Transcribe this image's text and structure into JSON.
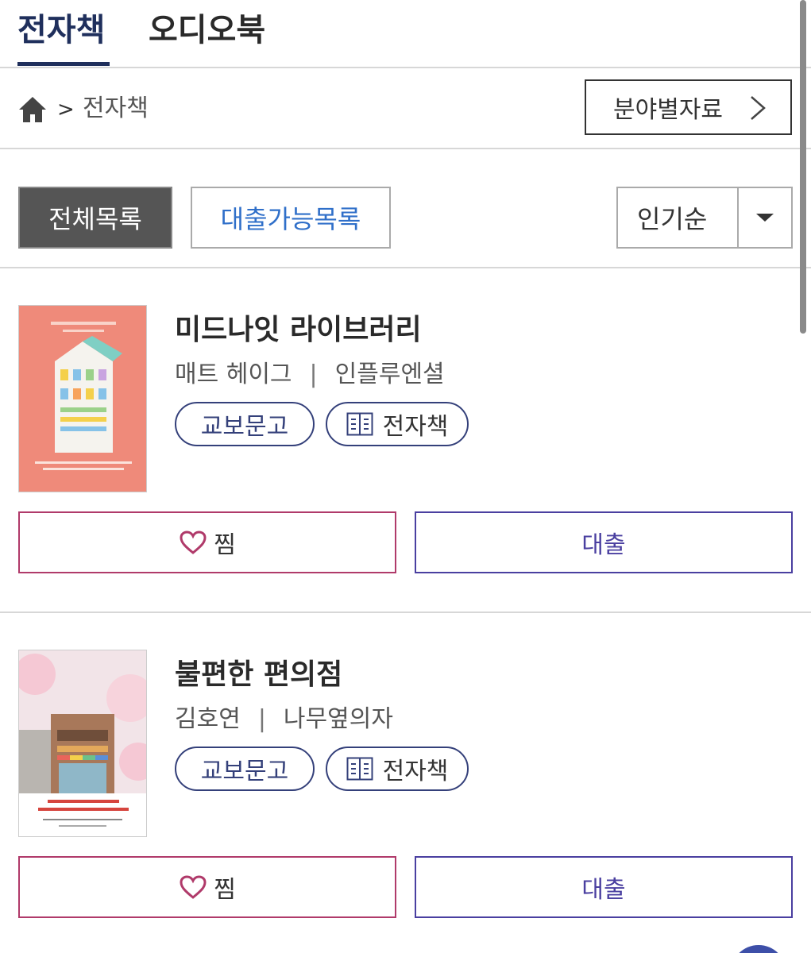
{
  "tabs": [
    {
      "label": "전자책",
      "active": true
    },
    {
      "label": "오디오북",
      "active": false
    }
  ],
  "breadcrumb": {
    "separator": ">",
    "current": "전자책"
  },
  "category_button": {
    "label": "분야별자료"
  },
  "filters": {
    "all_label": "전체목록",
    "available_label": "대출가능목록",
    "sort_selected": "인기순"
  },
  "books": [
    {
      "title": "미드나잇 라이브러리",
      "author": "매트 헤이그",
      "publisher": "인플루엔셜",
      "separator": "|",
      "provider": "교보문고",
      "format": "전자책",
      "wish_label": "찜",
      "loan_label": "대출",
      "cover_bg": "#ef8a7a"
    },
    {
      "title": "불편한 편의점",
      "author": "김호연",
      "publisher": "나무옆의자",
      "separator": "|",
      "provider": "교보문고",
      "format": "전자책",
      "wish_label": "찜",
      "loan_label": "대출",
      "cover_bg": "#f3e6ea"
    }
  ],
  "colors": {
    "tab_active": "#1f2f5c",
    "link_blue": "#2f6fc9",
    "wish_border": "#b03a6a",
    "loan_border": "#4a3fa0",
    "pill_border": "#34407a"
  }
}
